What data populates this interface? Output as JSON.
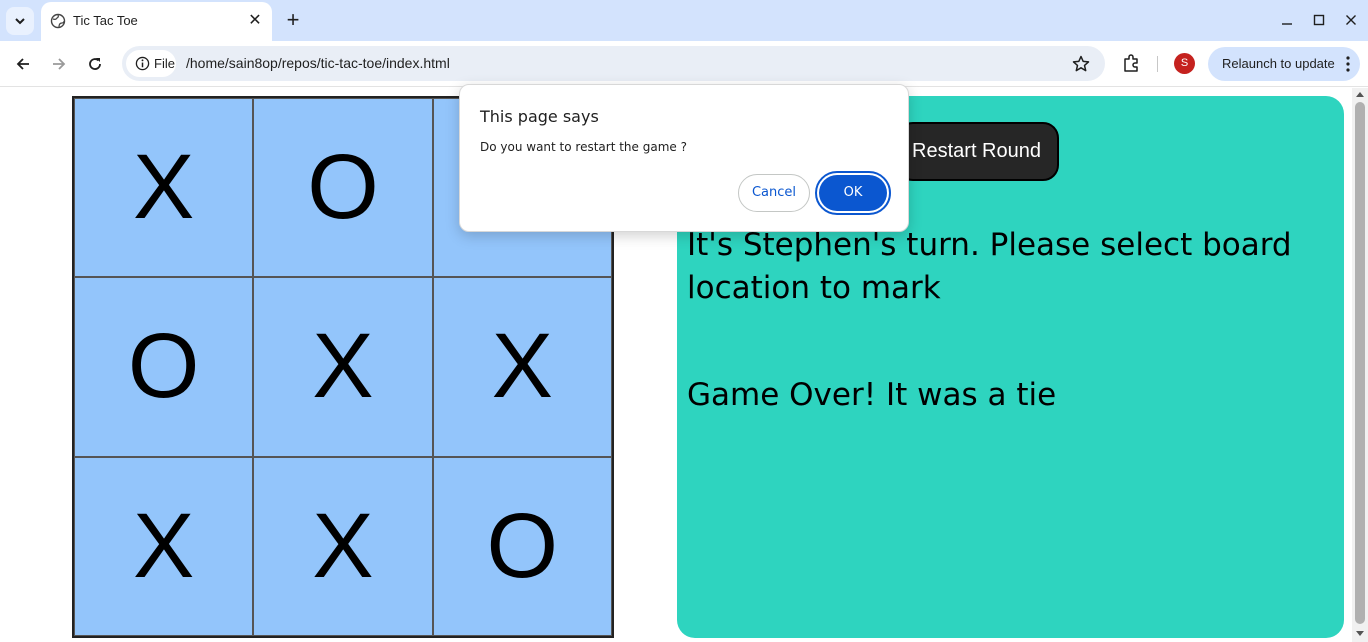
{
  "browser": {
    "tab": {
      "title": "Tic Tac Toe"
    },
    "address": {
      "chip_label": "File",
      "url": "/home/sain8op/repos/tic-tac-toe/index.html"
    },
    "profile_initial": "S",
    "relaunch_label": "Relaunch to update",
    "colors": {
      "tabstrip": "#d3e3fd",
      "omnibox": "#e9eef6",
      "avatar": "#c5221f"
    }
  },
  "game": {
    "board": [
      [
        "X",
        "O",
        ""
      ],
      [
        "O",
        "X",
        "X"
      ],
      [
        "X",
        "X",
        "O"
      ]
    ],
    "restart_label": "Restart Round",
    "turn_message": "It's Stephen's turn. Please select board location to mark",
    "result_message": "Game Over! It was a tie",
    "colors": {
      "board": "#93c5fb",
      "panel": "#2ed4bf",
      "button": "#262626"
    }
  },
  "dialog": {
    "title": "This page says",
    "message": "Do you want to restart the game ?",
    "cancel_label": "Cancel",
    "ok_label": "OK",
    "accent": "#0b57d0"
  }
}
